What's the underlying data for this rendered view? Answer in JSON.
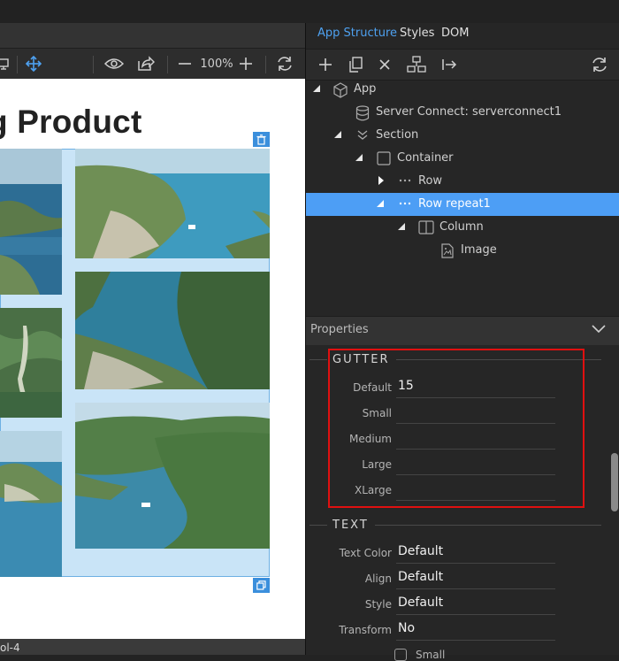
{
  "canvas": {
    "heading": "g Product",
    "zoom": "100%"
  },
  "status_bar": {
    "text": "ol-4"
  },
  "right_tabs": {
    "app_structure": "App Structure",
    "styles": "Styles",
    "dom": "DOM"
  },
  "tree": [
    {
      "label": "App",
      "icon": "cube-icon",
      "expanded": true
    },
    {
      "label": "Server Connect: serverconnect1",
      "icon": "database-icon"
    },
    {
      "label": "Section",
      "icon": "chevrons-down-icon",
      "expanded": true
    },
    {
      "label": "Container",
      "icon": "square-icon",
      "expanded": true
    },
    {
      "label": "Row",
      "icon": "dots-icon",
      "expanded": false
    },
    {
      "label": "Row repeat1",
      "icon": "dots-icon",
      "expanded": true,
      "selected": true
    },
    {
      "label": "Column",
      "icon": "columns-icon",
      "expanded": true
    },
    {
      "label": "Image",
      "icon": "image-icon"
    }
  ],
  "properties": {
    "title": "Properties",
    "gutter": {
      "title": "GUTTER",
      "fields": [
        {
          "label": "Default",
          "value": "15"
        },
        {
          "label": "Small",
          "value": ""
        },
        {
          "label": "Medium",
          "value": ""
        },
        {
          "label": "Large",
          "value": ""
        },
        {
          "label": "XLarge",
          "value": ""
        }
      ]
    },
    "text": {
      "title": "TEXT",
      "fields": [
        {
          "label": "Text Color",
          "value": "Default"
        },
        {
          "label": "Align",
          "value": "Default"
        },
        {
          "label": "Style",
          "value": "Default"
        },
        {
          "label": "Transform",
          "value": "No"
        }
      ],
      "small_option": "Small"
    }
  },
  "colors": {
    "accent": "#4ea1f0",
    "selection": "#4d9ef5",
    "highlight": "#e01010"
  }
}
